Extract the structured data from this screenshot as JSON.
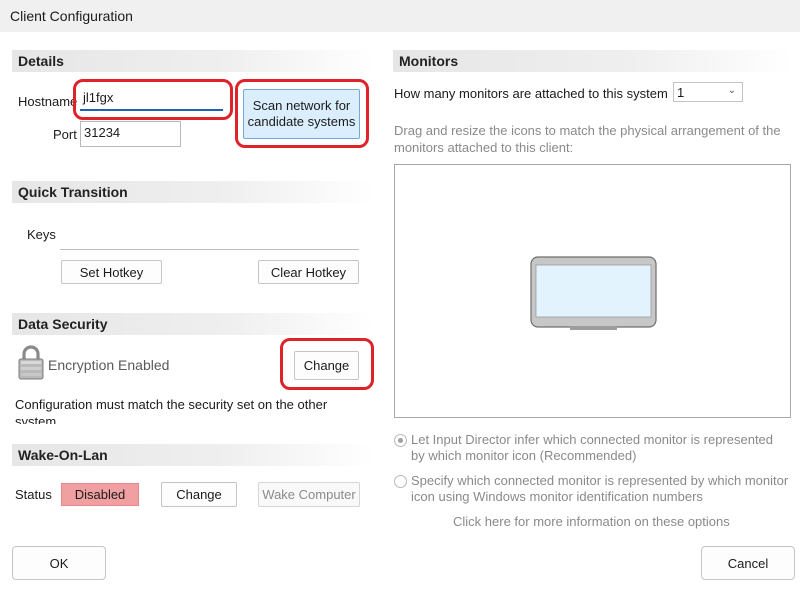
{
  "window": {
    "title": "Client Configuration"
  },
  "details": {
    "header": "Details",
    "hostname_label": "Hostname",
    "hostname_value": "jl1fgx",
    "port_label": "Port",
    "port_value": "31234",
    "scan_button_line1": "Scan network for",
    "scan_button_line2": "candidate systems"
  },
  "quick_transition": {
    "header": "Quick Transition",
    "keys_label": "Keys",
    "set_hotkey": "Set Hotkey",
    "clear_hotkey": "Clear Hotkey"
  },
  "data_security": {
    "header": "Data Security",
    "icon": "padlock-icon",
    "status_text": "Encryption Enabled",
    "change_button": "Change",
    "note": "Configuration must match the security set on the other system"
  },
  "wake_on_lan": {
    "header": "Wake-On-Lan",
    "status_label": "Status",
    "status_value": "Disabled",
    "status_color": "#f0a0a0",
    "change_button": "Change",
    "wake_button": "Wake Computer"
  },
  "monitors": {
    "header": "Monitors",
    "count_question": "How many monitors are attached to this system",
    "count_value": "1",
    "instructions": "Drag and resize the icons to match the physical arrangement of the monitors attached to this client:",
    "monitor_icon": "monitor-icon",
    "option1_line1": "Let Input Director infer which connected monitor is represented",
    "option1_line2": "by which monitor icon (Recommended)",
    "option2_line1": "Specify which connected monitor is represented by which monitor",
    "option2_line2": "icon using Windows monitor identification numbers",
    "info_link": "Click here for more information on these options"
  },
  "footer": {
    "ok": "OK",
    "cancel": "Cancel"
  },
  "highlight_color": "#e0222b"
}
